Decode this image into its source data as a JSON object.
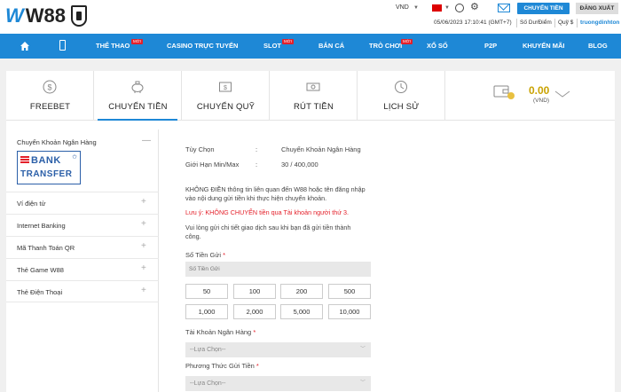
{
  "header": {
    "logo_text": "W88",
    "currency": "VND",
    "transfer_button": "CHUYỂN TIỀN",
    "logout_button": "ĐĂNG XUẤT",
    "datetime": "05/06/2023 17:10:41 (GMT+7)",
    "balance_link": "Số Dư/Điểm",
    "fund_link": "Quỹ $",
    "username": "truongdinhton"
  },
  "nav": {
    "items": [
      {
        "label": "THỂ THAO",
        "badge": "MỚI"
      },
      {
        "label": "CASINO TRỰC TUYẾN"
      },
      {
        "label": "SLOT",
        "badge": "MỚI"
      },
      {
        "label": "BẮN CÁ"
      },
      {
        "label": "TRÒ CHƠI",
        "badge": "MỚI"
      },
      {
        "label": "XỔ SỐ"
      },
      {
        "label": "P2P"
      },
      {
        "label": "KHUYẾN MÃI"
      },
      {
        "label": "BLOG"
      }
    ]
  },
  "tabs": [
    {
      "label": "FREEBET",
      "icon": "dollar-coin-icon"
    },
    {
      "label": "CHUYỂN TIỀN",
      "icon": "piggy-bank-icon",
      "active": true
    },
    {
      "label": "CHUYỂN QUỸ",
      "icon": "transfer-icon"
    },
    {
      "label": "RÚT TIỀN",
      "icon": "cash-icon"
    },
    {
      "label": "LỊCH SỬ",
      "icon": "history-icon"
    }
  ],
  "wallet": {
    "amount": "0.00",
    "currency": "(VND)"
  },
  "sidebar": {
    "header": "Chuyển Khoản Ngân Hàng",
    "bank_logo_line1": "BANK",
    "bank_logo_line2": "TRANSFER",
    "items": [
      {
        "label": "Ví điện tử"
      },
      {
        "label": "Internet Banking"
      },
      {
        "label": "Mã Thanh Toán QR"
      },
      {
        "label": "Thẻ Game W88"
      },
      {
        "label": "Thẻ Điện Thoại"
      }
    ]
  },
  "form": {
    "option_label": "Tùy Chọn",
    "option_value": "Chuyển Khoản Ngân Hàng",
    "limit_label": "Giới Hạn Min/Max",
    "limit_value": "30 / 400,000",
    "colon": ":",
    "notice1": "KHÔNG ĐIỀN thông tin liên quan đến W88 hoặc tên đăng nhập vào nội dung gửi tiền khi thực hiện chuyển khoản.",
    "notice2": "Lưu ý: KHÔNG CHUYỂN tiền qua Tài khoản người thứ 3.",
    "notice3": "Vui lòng gửi chi tiết giao dịch sau khi bạn đã gửi tiền thành công.",
    "amount_label": "Số Tiền Gửi",
    "amount_placeholder": "Số Tiền Gửi",
    "required_mark": "*",
    "amounts": [
      "50",
      "100",
      "200",
      "500",
      "1,000",
      "2,000",
      "5,000",
      "10,000"
    ],
    "bank_account_label": "Tài Khoản Ngân Hàng",
    "bank_account_placeholder": "--Lựa Chọn--",
    "method_label": "Phương Thức Gửi Tiền",
    "method_placeholder": "--Lựa Chọn--"
  }
}
